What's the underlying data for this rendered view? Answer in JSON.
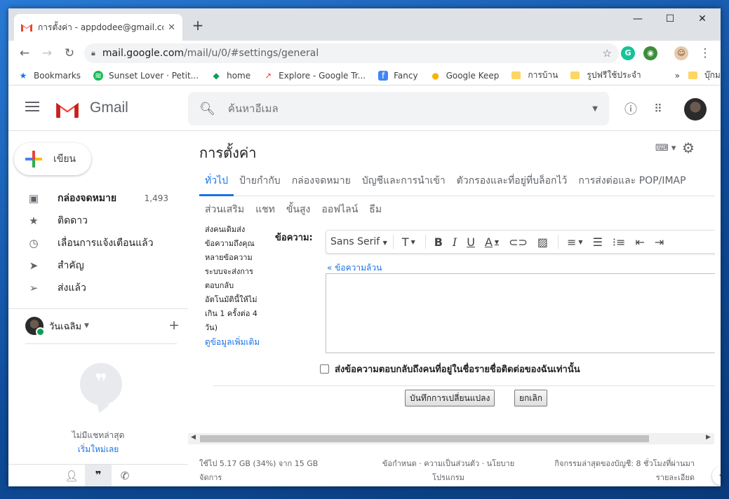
{
  "browser": {
    "tab_title": "การตั้งค่า - appdodee@gmail.com",
    "url_host": "mail.google.com",
    "url_path": "/mail/u/0/#settings/general",
    "bookmarks": [
      {
        "label": "Bookmarks",
        "icon": "star-icon",
        "color": "#1a73e8"
      },
      {
        "label": "Sunset Lover · Petit...",
        "icon": "spotify-icon",
        "color": "#1db954"
      },
      {
        "label": "home",
        "icon": "home-diamond-icon",
        "color": "#0f9d58"
      },
      {
        "label": "Explore - Google Tr...",
        "icon": "trends-icon",
        "color": "#ea4335"
      },
      {
        "label": "Fancy",
        "icon": "fancy-icon",
        "color": "#4285f4"
      },
      {
        "label": "Google Keep",
        "icon": "keep-icon",
        "color": "#f4b400"
      },
      {
        "label": "การบ้าน",
        "icon": "folder-icon",
        "color": "#fdd663"
      },
      {
        "label": "รูปฟรีใช้ประจำ",
        "icon": "folder-icon",
        "color": "#fdd663"
      }
    ],
    "overflow": "»",
    "other_bookmarks": "บุ๊กมาร์กอื่นๆ"
  },
  "gmail": {
    "brand": "Gmail",
    "search_placeholder": "ค้นหาอีเมล",
    "compose_label": "เขียน",
    "nav": [
      {
        "label": "กล่องจดหมาย",
        "count": "1,493",
        "icon": "inbox-icon",
        "bold": true
      },
      {
        "label": "ติดดาว",
        "count": "",
        "icon": "star-icon",
        "bold": false
      },
      {
        "label": "เลื่อนการแจ้งเตือนแล้ว",
        "count": "",
        "icon": "clock-icon",
        "bold": false
      },
      {
        "label": "สำคัญ",
        "count": "",
        "icon": "important-icon",
        "bold": false
      },
      {
        "label": "ส่งแล้ว",
        "count": "",
        "icon": "send-icon",
        "bold": false
      }
    ],
    "hangouts_user": "วันเฉลิม",
    "no_recent_chats": "ไม่มีแชทล่าสุด",
    "start_new": "เริ่มใหม่เลย"
  },
  "settings": {
    "title": "การตั้งค่า",
    "tabs_row1": [
      "ทั่วไป",
      "ป้ายกำกับ",
      "กล่องจดหมาย",
      "บัญชีและการนำเข้า",
      "ตัวกรองและที่อยู่ที่บล็อกไว้",
      "การส่งต่อและ POP/IMAP"
    ],
    "tabs_row2": [
      "ส่วนเสริม",
      "แชท",
      "ขั้นสูง",
      "ออฟไลน์",
      "ธีม"
    ],
    "active_tab": "ทั่วไป",
    "help_lines": [
      "ส่งคนเดิมส่ง",
      "ข้อความถึงคุณ",
      "หลายข้อความ",
      "ระบบจะส่งการ",
      "ตอบกลับ",
      "อัตโนมัตินี้ให้ไม่",
      "เกิน 1 ครั้งต่อ 4",
      "วัน)"
    ],
    "learn_more": "ดูข้อมูลเพิ่มเติม",
    "message_label": "ข้อความ:",
    "font_name": "Sans Serif",
    "plain_text_link": "« ข้อความล้วน",
    "checkbox_label": "ส่งข้อความตอบกลับถึงคนที่อยู่ในชื่อรายชื่อติดต่อของฉันเท่านั้น",
    "save_button": "บันทึกการเปลี่ยนแปลง",
    "cancel_button": "ยกเลิก"
  },
  "footer": {
    "usage_line1": "ใช้ไป 5.17 GB (34%) จาก 15 GB",
    "usage_line2": "จัดการ",
    "terms_line1": "ข้อกำหนด · ความเป็นส่วนตัว · นโยบาย",
    "terms_line2": "โปรแกรม",
    "activity_line1": "กิจกรรมล่าสุดของบัญชี: 8 ชั่วโมงที่ผ่านมา",
    "activity_line2": "รายละเอียด"
  },
  "colors": {
    "accent": "#1a73e8",
    "gmail_red": "#ea4335"
  }
}
